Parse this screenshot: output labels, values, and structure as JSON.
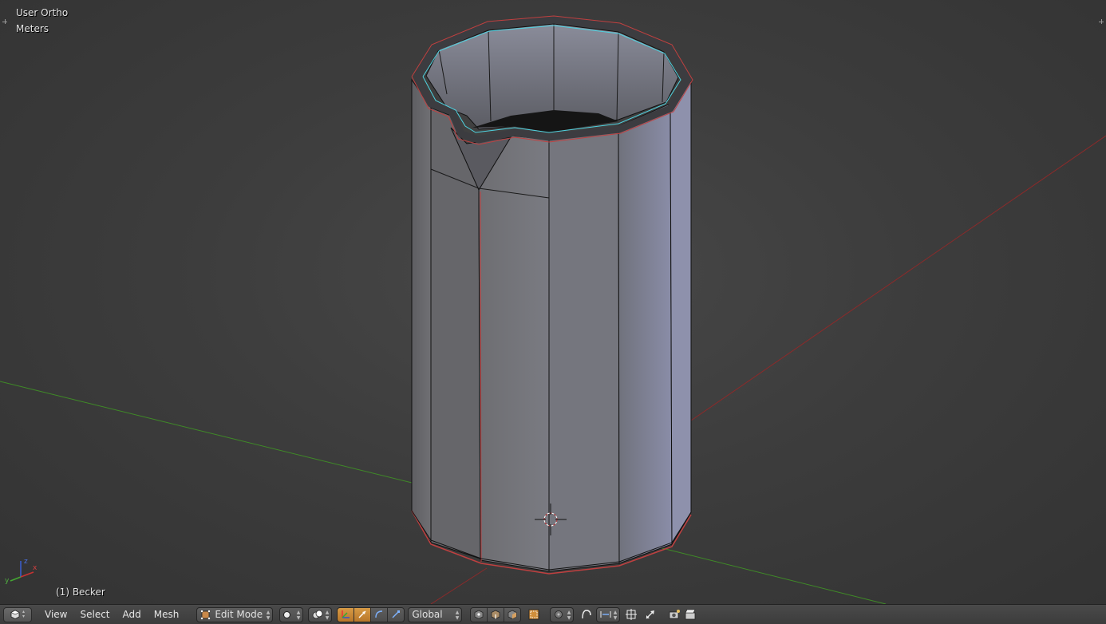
{
  "viewport": {
    "view_name": "User Ortho",
    "units": "Meters",
    "object_name": "(1) Becker"
  },
  "header": {
    "editor_type_icon": "3d-view-icon",
    "menus": [
      "View",
      "Select",
      "Add",
      "Mesh"
    ],
    "mode": "Edit Mode",
    "mode_icon": "edit-mode-icon",
    "viewport_shading_icon": "solid-sphere-icon",
    "pivot_point_icon": "pivot-point-icon",
    "manipulator_icons": [
      "manipulator-toggle-icon",
      "translate-icon",
      "rotate-icon",
      "scale-icon"
    ],
    "orientation": "Global",
    "select_mode_icons": [
      "vertex-select-icon",
      "edge-select-icon",
      "face-select-icon"
    ],
    "occlude_icon": "occlude-geometry-icon",
    "proportional_icon": "proportional-editing-icon",
    "falloff_icon": "falloff-icon",
    "snap_icons": [
      "snap-magnet-icon",
      "snap-element-icon",
      "snap-target-icon"
    ],
    "render_icons": [
      "render-icon",
      "render-animation-icon"
    ]
  },
  "colors": {
    "x_axis": "#8c2a2a",
    "y_axis": "#3f8a27",
    "active_button": "#d08e3a",
    "mesh_face": "#7c7f90",
    "seam_edge": "#c04040",
    "selected_edge": "#4fd2e0"
  }
}
